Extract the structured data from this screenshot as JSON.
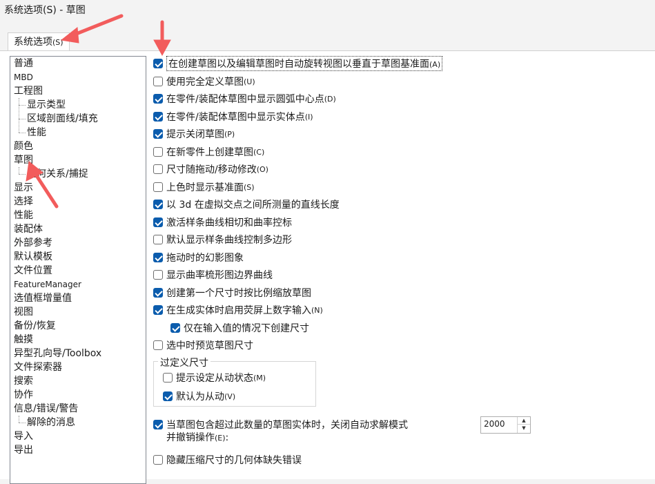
{
  "window": {
    "title": "系统选项(S) - 草图"
  },
  "tabs": [
    {
      "label": "系统选项",
      "mnemonic": "(S)"
    }
  ],
  "tree": {
    "items": [
      {
        "label": "普通"
      },
      {
        "label": "MBD"
      },
      {
        "label": "工程图"
      },
      {
        "label": "显示类型"
      },
      {
        "label": "区域剖面线/填充"
      },
      {
        "label": "性能"
      },
      {
        "label": "颜色"
      },
      {
        "label": "草图"
      },
      {
        "label": "几何关系/捕捉"
      },
      {
        "label": "显示"
      },
      {
        "label": "选择"
      },
      {
        "label": "性能"
      },
      {
        "label": "装配体"
      },
      {
        "label": "外部参考"
      },
      {
        "label": "默认模板"
      },
      {
        "label": "文件位置"
      },
      {
        "label": "FeatureManager"
      },
      {
        "label": "选值框增量值"
      },
      {
        "label": "视图"
      },
      {
        "label": "备份/恢复"
      },
      {
        "label": "触摸"
      },
      {
        "label": "异型孔向导/Toolbox"
      },
      {
        "label": "文件探索器"
      },
      {
        "label": "搜索"
      },
      {
        "label": "协作"
      },
      {
        "label": "信息/错误/警告"
      },
      {
        "label": "解除的消息"
      },
      {
        "label": "导入"
      },
      {
        "label": "导出"
      }
    ]
  },
  "options": [
    {
      "label": "在创建草图以及编辑草图时自动旋转视图以垂直于草图基准面",
      "mnemonic": "(A)",
      "checked": true
    },
    {
      "label": "使用完全定义草图",
      "mnemonic": "(U)",
      "checked": false
    },
    {
      "label": "在零件/装配体草图中显示圆弧中心点",
      "mnemonic": "(D)",
      "checked": true
    },
    {
      "label": "在零件/装配体草图中显示实体点",
      "mnemonic": "(I)",
      "checked": true
    },
    {
      "label": "提示关闭草图",
      "mnemonic": "(P)",
      "checked": true
    },
    {
      "label": "在新零件上创建草图",
      "mnemonic": "(C)",
      "checked": false
    },
    {
      "label": "尺寸随拖动/移动修改",
      "mnemonic": "(O)",
      "checked": false
    },
    {
      "label": "上色时显示基准面",
      "mnemonic": "(S)",
      "checked": false
    },
    {
      "label": "以 3d 在虚拟交点之间所测量的直线长度",
      "mnemonic": "",
      "checked": true
    },
    {
      "label": "激活样条曲线相切和曲率控标",
      "mnemonic": "",
      "checked": true
    },
    {
      "label": "默认显示样条曲线控制多边形",
      "mnemonic": "",
      "checked": false
    },
    {
      "label": "拖动时的幻影图象",
      "mnemonic": "",
      "checked": true
    },
    {
      "label": "显示曲率梳形图边界曲线",
      "mnemonic": "",
      "checked": false
    },
    {
      "label": "创建第一个尺寸时按比例缩放草图",
      "mnemonic": "",
      "checked": true
    },
    {
      "label": "在生成实体时启用荧屏上数字输入",
      "mnemonic": "(N)",
      "checked": true
    },
    {
      "label": "仅在输入值的情况下创建尺寸",
      "mnemonic": "",
      "checked": true
    },
    {
      "label": "选中时预览草图尺寸",
      "mnemonic": "",
      "checked": false
    }
  ],
  "overdefined": {
    "title": "过定义尺寸",
    "options": [
      {
        "label": "提示设定从动状态",
        "mnemonic": "(M)",
        "checked": false
      },
      {
        "label": "默认为从动",
        "mnemonic": "(V)",
        "checked": true
      }
    ]
  },
  "solver": {
    "line1": "当草图包含超过此数量的草图实体时，关闭自动求解模式",
    "line2": "并撤销操作",
    "mnemonic": "(E)",
    "suffix": ":",
    "checked": true,
    "value": "2000"
  },
  "last_option": {
    "label": "隐藏压缩尺寸的几何体缺失错误",
    "checked": false
  },
  "colors": {
    "accent": "#0b5cad",
    "annotation_arrow": "#f25c5c"
  }
}
